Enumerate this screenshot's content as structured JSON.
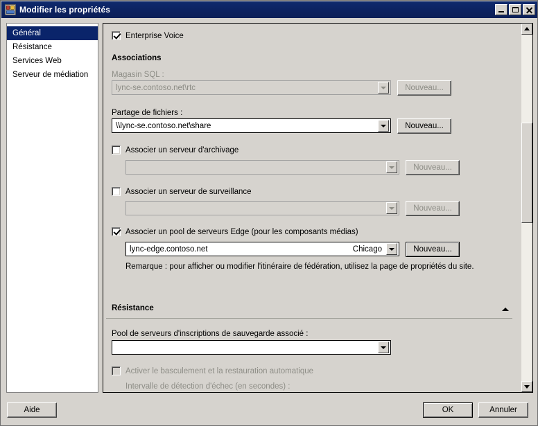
{
  "window": {
    "title": "Modifier les propriétés",
    "icon": "server-properties-icon",
    "minimize_label": "Réduire",
    "maximize_label": "Agrandir",
    "close_label": "Fermer"
  },
  "sidebar": {
    "items": [
      {
        "label": "Général",
        "selected": true
      },
      {
        "label": "Résistance",
        "selected": false
      },
      {
        "label": "Services Web",
        "selected": false
      },
      {
        "label": "Serveur de médiation",
        "selected": false
      }
    ]
  },
  "main": {
    "enterprise_voice": {
      "label": "Enterprise Voice",
      "checked": true,
      "enabled": true
    },
    "associations": {
      "heading": "Associations",
      "sql_store": {
        "label": "Magasin SQL :",
        "value": "lync-se.contoso.net\\rtc",
        "enabled": false,
        "button": "Nouveau..."
      },
      "file_share": {
        "label": "Partage de fichiers :",
        "value": "\\\\lync-se.contoso.net\\share",
        "enabled": true,
        "button": "Nouveau..."
      },
      "archiving_server": {
        "label": "Associer un serveur d'archivage",
        "checked": false,
        "value": "",
        "enabled": false,
        "button": "Nouveau..."
      },
      "monitoring_server": {
        "label": "Associer un serveur de surveillance",
        "checked": false,
        "value": "",
        "enabled": false,
        "button": "Nouveau..."
      },
      "edge_pool": {
        "label": "Associer un pool de serveurs Edge (pour les composants médias)",
        "checked": true,
        "value": "lync-edge.contoso.net",
        "value_right": "Chicago",
        "enabled": true,
        "button": "Nouveau...",
        "note": "Remarque : pour afficher ou modifier l'itinéraire de fédération, utilisez la page de propriétés du site."
      }
    },
    "resilience": {
      "heading": "Résistance",
      "collapse_icon": "chevron-up-icon",
      "backup_pool": {
        "label": "Pool de serveurs d'inscriptions de sauvegarde associé :",
        "value": "",
        "enabled": true
      },
      "auto_failover": {
        "label": "Activer le basculement et la restauration automatique",
        "checked": false,
        "enabled": false
      },
      "failure_detection": {
        "label": "Intervalle de détection d'échec (en secondes) :",
        "value": "",
        "enabled": false
      }
    }
  },
  "footer": {
    "help": "Aide",
    "ok": "OK",
    "cancel": "Annuler"
  },
  "colors": {
    "titlebar": "#0c2260",
    "selection": "#0a246a",
    "face": "#d6d3ce",
    "disabled_text": "#8d8d86",
    "field": "#ffffff"
  }
}
